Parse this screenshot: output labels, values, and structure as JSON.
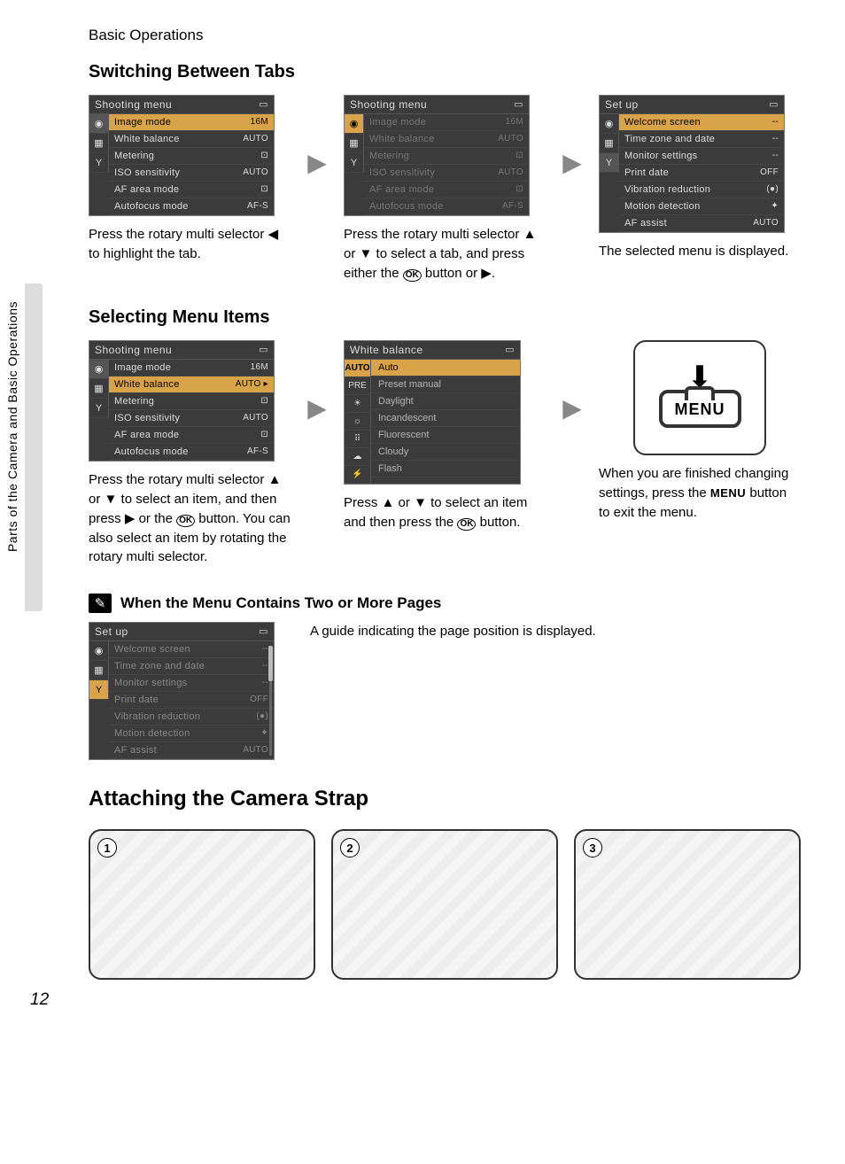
{
  "header": "Basic Operations",
  "side_tab": "Parts of the Camera and Basic Operations",
  "page_number": "12",
  "section1": {
    "title": "Switching Between Tabs",
    "menu_title": "Shooting menu",
    "items": [
      {
        "label": "Image mode",
        "value": "16M"
      },
      {
        "label": "White balance",
        "value": "AUTO"
      },
      {
        "label": "Metering",
        "value": "⊡"
      },
      {
        "label": "ISO sensitivity",
        "value": "AUTO"
      },
      {
        "label": "AF area mode",
        "value": "⊡"
      },
      {
        "label": "Autofocus mode",
        "value": "AF-S"
      }
    ],
    "setup_title": "Set up",
    "setup_items": [
      {
        "label": "Welcome screen",
        "value": "--"
      },
      {
        "label": "Time zone and date",
        "value": "--"
      },
      {
        "label": "Monitor settings",
        "value": "--"
      },
      {
        "label": "Print date",
        "value": "OFF"
      },
      {
        "label": "Vibration reduction",
        "value": "(●)"
      },
      {
        "label": "Motion detection",
        "value": "✦"
      },
      {
        "label": "AF assist",
        "value": "AUTO"
      }
    ],
    "cap1a": "Press the rotary multi selector ",
    "cap1b": " to highlight the tab.",
    "cap2a": "Press the rotary multi selector ",
    "cap2b": " or ",
    "cap2c": " to select a tab, and press either the ",
    "cap2d": " button or ",
    "cap2e": ".",
    "cap3": "The selected menu is displayed."
  },
  "section2": {
    "title": "Selecting Menu Items",
    "wb_title": "White balance",
    "wb_options": [
      {
        "tag": "AUTO",
        "label": "Auto",
        "sel": true
      },
      {
        "tag": "PRE",
        "label": "Preset manual"
      },
      {
        "tag": "☀",
        "label": "Daylight"
      },
      {
        "tag": "☼",
        "label": "Incandescent"
      },
      {
        "tag": "⠿",
        "label": "Fluorescent"
      },
      {
        "tag": "☁",
        "label": "Cloudy"
      },
      {
        "tag": "⚡",
        "label": "Flash"
      }
    ],
    "menu_button": "MENU",
    "cap1a": "Press the rotary multi selector ",
    "cap1b": " or ",
    "cap1c": " to select an item, and then press ",
    "cap1d": " or the ",
    "cap1e": " button. You can also select an item by rotating the rotary multi selector.",
    "cap2a": "Press ",
    "cap2b": " or ",
    "cap2c": " to select an item and then press the ",
    "cap2d": " button.",
    "cap3a": "When you are finished changing settings, press the ",
    "cap3b": " button to exit the menu."
  },
  "note": {
    "title": "When the Menu Contains Two or More Pages",
    "caption": "A guide indicating the page position is displayed."
  },
  "section3": {
    "title": "Attaching the Camera Strap",
    "steps": [
      "1",
      "2",
      "3"
    ]
  },
  "glyphs": {
    "left": "◀",
    "right": "▶",
    "up": "▲",
    "down": "▼",
    "ok": "OK",
    "menu": "MENU",
    "battery": "▭"
  }
}
